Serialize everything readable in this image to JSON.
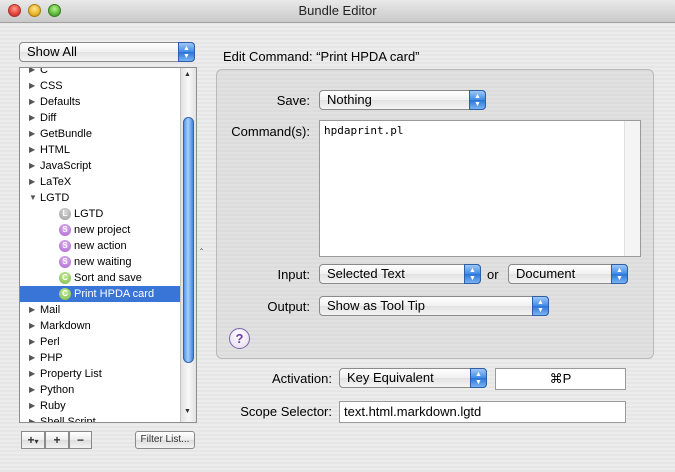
{
  "window": {
    "title": "Bundle Editor"
  },
  "sidebar": {
    "filter_popup": "Show All",
    "items": [
      {
        "label": "C",
        "expanded": false,
        "child": false
      },
      {
        "label": "CSS",
        "expanded": false,
        "child": false
      },
      {
        "label": "Defaults",
        "expanded": false,
        "child": false
      },
      {
        "label": "Diff",
        "expanded": false,
        "child": false
      },
      {
        "label": "GetBundle",
        "expanded": false,
        "child": false
      },
      {
        "label": "HTML",
        "expanded": false,
        "child": false
      },
      {
        "label": "JavaScript",
        "expanded": false,
        "child": false
      },
      {
        "label": "LaTeX",
        "expanded": false,
        "child": false
      },
      {
        "label": "LGTD",
        "expanded": true,
        "child": false
      },
      {
        "label": "LGTD",
        "child": true,
        "badge": "L",
        "badge_name": "language-icon"
      },
      {
        "label": "new project",
        "child": true,
        "badge": "S",
        "badge_name": "snippet-icon"
      },
      {
        "label": "new action",
        "child": true,
        "badge": "S",
        "badge_name": "snippet-icon"
      },
      {
        "label": "new waiting",
        "child": true,
        "badge": "S",
        "badge_name": "snippet-icon"
      },
      {
        "label": "Sort and save",
        "child": true,
        "badge": "C",
        "badge_name": "command-icon"
      },
      {
        "label": "Print HPDA card",
        "child": true,
        "badge": "C",
        "badge_name": "command-icon",
        "selected": true
      },
      {
        "label": "Mail",
        "expanded": false,
        "child": false
      },
      {
        "label": "Markdown",
        "expanded": false,
        "child": false
      },
      {
        "label": "Perl",
        "expanded": false,
        "child": false
      },
      {
        "label": "PHP",
        "expanded": false,
        "child": false
      },
      {
        "label": "Property List",
        "expanded": false,
        "child": false
      },
      {
        "label": "Python",
        "expanded": false,
        "child": false
      },
      {
        "label": "Ruby",
        "expanded": false,
        "child": false
      },
      {
        "label": "Shell Script",
        "expanded": false,
        "child": false
      }
    ],
    "add_button": "+",
    "add_menu_glyph": "▾",
    "add_item_button": "+",
    "remove_button": "−",
    "filter_list_button": "Filter List..."
  },
  "editor": {
    "heading": "Edit Command: “Print HPDA card”",
    "save_label": "Save:",
    "save_value": "Nothing",
    "command_label": "Command(s):",
    "command_text": "hpdaprint.pl",
    "input_label": "Input:",
    "input_value": "Selected Text",
    "or_label": "or",
    "input_fallback_value": "Document",
    "output_label": "Output:",
    "output_value": "Show as Tool Tip",
    "help_glyph": "?",
    "activation_label": "Activation:",
    "activation_value": "Key Equivalent",
    "key_equivalent": "⌘P",
    "scope_label": "Scope Selector:",
    "scope_value": "text.html.markdown.lgtd",
    "collapse_glyph": "‸"
  }
}
